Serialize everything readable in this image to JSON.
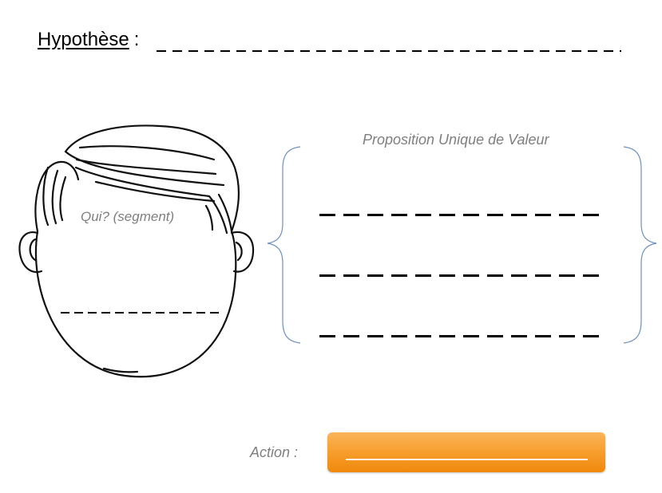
{
  "hypothesis": {
    "label": "Hypothèse",
    "colon": ":"
  },
  "face": {
    "segment_label": "Qui? (segment)"
  },
  "value_proposition": {
    "title": "Proposition Unique de Valeur",
    "blank_lines": 3
  },
  "action": {
    "label": "Action :",
    "button_color": "#f7a030"
  },
  "colors": {
    "label_gray": "#7f7f7f",
    "brace_blue": "#6f8fbf",
    "ink": "#000000"
  },
  "icons": [
    "head-drawing-icon",
    "left-brace-icon",
    "right-brace-icon"
  ]
}
